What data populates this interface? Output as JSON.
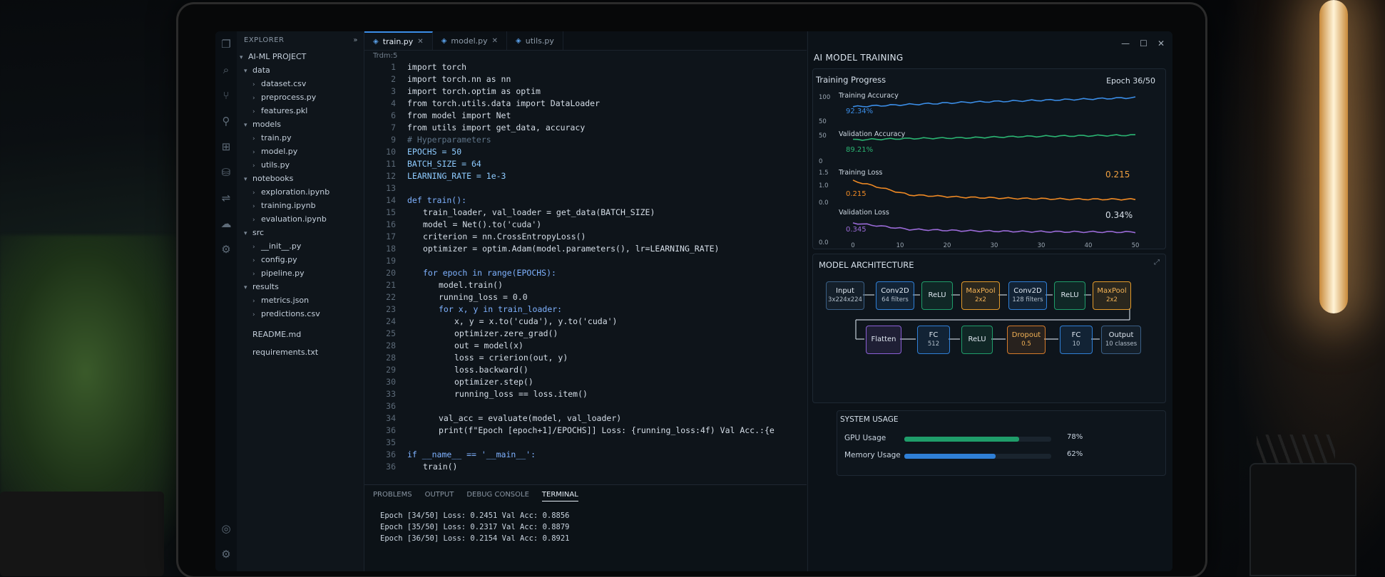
{
  "explorer": {
    "header": "EXPLORER",
    "project": "AI-ML PROJECT",
    "tree": [
      {
        "label": "data",
        "depth": 0,
        "folder": true,
        "open": true
      },
      {
        "label": "dataset.csv",
        "depth": 1,
        "folder": false
      },
      {
        "label": "preprocess.py",
        "depth": 1,
        "folder": false
      },
      {
        "label": "features.pkl",
        "depth": 1,
        "folder": false
      },
      {
        "label": "models",
        "depth": 0,
        "folder": true,
        "open": true
      },
      {
        "label": "train.py",
        "depth": 1,
        "folder": false
      },
      {
        "label": "model.py",
        "depth": 1,
        "folder": false
      },
      {
        "label": "utils.py",
        "depth": 1,
        "folder": false
      },
      {
        "label": "notebooks",
        "depth": 0,
        "folder": true,
        "open": true
      },
      {
        "label": "exploration.ipynb",
        "depth": 1,
        "folder": false
      },
      {
        "label": "training.ipynb",
        "depth": 1,
        "folder": false
      },
      {
        "label": "evaluation.ipynb",
        "depth": 1,
        "folder": false
      },
      {
        "label": "src",
        "depth": 0,
        "folder": true,
        "open": true
      },
      {
        "label": "__init__.py",
        "depth": 1,
        "folder": false
      },
      {
        "label": "config.py",
        "depth": 1,
        "folder": false
      },
      {
        "label": "pipeline.py",
        "depth": 1,
        "folder": false
      },
      {
        "label": "results",
        "depth": 0,
        "folder": true,
        "open": true
      },
      {
        "label": "metrics.json",
        "depth": 1,
        "folder": false
      },
      {
        "label": "predictions.csv",
        "depth": 1,
        "folder": false
      },
      {
        "label": "README.md",
        "depth": 0,
        "folder": false
      },
      {
        "label": "requirements.txt",
        "depth": 0,
        "folder": false
      }
    ]
  },
  "editor": {
    "tabs": [
      {
        "label": "train.py",
        "active": true
      },
      {
        "label": "model.py",
        "active": false
      },
      {
        "label": "utils.py",
        "active": false
      }
    ],
    "breadcrumb": "Trdm:5",
    "lines": [
      {
        "n": "1",
        "indent": 0,
        "text": "import torch",
        "cls": "ct"
      },
      {
        "n": "2",
        "indent": 0,
        "text": "import torch.nn as nn",
        "cls": "ct"
      },
      {
        "n": "3",
        "indent": 0,
        "text": "import torch.optim as optim",
        "cls": "ct"
      },
      {
        "n": "4",
        "indent": 0,
        "text": "from torch.utils.data import DataLoader",
        "cls": "ct"
      },
      {
        "n": "6",
        "indent": 0,
        "text": "from model import Net",
        "cls": "ct"
      },
      {
        "n": "7",
        "indent": 0,
        "text": "from utils import get_data, accuracy",
        "cls": "ct"
      },
      {
        "n": "9",
        "indent": 0,
        "text": "# Hyperparameters",
        "cls": "cm"
      },
      {
        "n": "10",
        "indent": 0,
        "text": "EPOCHS = 50",
        "cls": "cn"
      },
      {
        "n": "11",
        "indent": 0,
        "text": "BATCH_SIZE = 64",
        "cls": "cn"
      },
      {
        "n": "12",
        "indent": 0,
        "text": "LEARNING_RATE = 1e-3",
        "cls": "cn"
      },
      {
        "n": "13",
        "indent": 0,
        "text": "",
        "cls": "ct"
      },
      {
        "n": "14",
        "indent": 0,
        "text": "def train():",
        "cls": "kw"
      },
      {
        "n": "15",
        "indent": 1,
        "text": "train_loader, val_loader = get_data(BATCH_SIZE)",
        "cls": "ct"
      },
      {
        "n": "16",
        "indent": 1,
        "text": "model = Net().to('cuda')",
        "cls": "ct"
      },
      {
        "n": "17",
        "indent": 1,
        "text": "criterion = nn.CrossEntropyLoss()",
        "cls": "ct"
      },
      {
        "n": "18",
        "indent": 1,
        "text": "optimizer = optim.Adam(model.parameters(), lr=LEARNING_RATE)",
        "cls": "ct"
      },
      {
        "n": "19",
        "indent": 0,
        "text": "",
        "cls": "ct"
      },
      {
        "n": "20",
        "indent": 1,
        "text": "for epoch in range(EPOCHS):",
        "cls": "kw"
      },
      {
        "n": "21",
        "indent": 2,
        "text": "model.train()",
        "cls": "ct"
      },
      {
        "n": "22",
        "indent": 2,
        "text": "running_loss = 0.0",
        "cls": "ct"
      },
      {
        "n": "23",
        "indent": 2,
        "text": "for x, y in train_loader:",
        "cls": "kw"
      },
      {
        "n": "24",
        "indent": 3,
        "text": "x, y = x.to('cuda'), y.to('cuda')",
        "cls": "ct"
      },
      {
        "n": "25",
        "indent": 3,
        "text": "optimizer.zere_grad()",
        "cls": "ct"
      },
      {
        "n": "28",
        "indent": 3,
        "text": "out = model(x)",
        "cls": "ct"
      },
      {
        "n": "28",
        "indent": 3,
        "text": "loss = crierion(out, y)",
        "cls": "ct"
      },
      {
        "n": "29",
        "indent": 3,
        "text": "loss.backward()",
        "cls": "ct"
      },
      {
        "n": "30",
        "indent": 3,
        "text": "optimizer.step()",
        "cls": "ct"
      },
      {
        "n": "33",
        "indent": 3,
        "text": "running_loss == loss.item()",
        "cls": "ct"
      },
      {
        "n": "36",
        "indent": 0,
        "text": "",
        "cls": "ct"
      },
      {
        "n": "34",
        "indent": 2,
        "text": "val_acc = evaluate(model, val_loader)",
        "cls": "ct"
      },
      {
        "n": "36",
        "indent": 2,
        "text": "print(f\"Epoch [epoch+1]/EPOCHS]] Loss: {running_loss:4f) Val Acc.:{e",
        "cls": "ct"
      },
      {
        "n": "35",
        "indent": 2,
        "text": "",
        "cls": "ct"
      },
      {
        "n": "36",
        "indent": 0,
        "text": "if __name__ == '__main__':",
        "cls": "kw"
      },
      {
        "n": "36",
        "indent": 1,
        "text": "train()",
        "cls": "ct"
      }
    ]
  },
  "panel": {
    "tabs": [
      {
        "label": "PROBLEMS",
        "active": false
      },
      {
        "label": "OUTPUT",
        "active": false
      },
      {
        "label": "DEBUG CONSOLE",
        "active": false
      },
      {
        "label": "TERMINAL",
        "active": true
      }
    ],
    "lines": [
      "Epoch [34/50] Loss: 0.2451 Val Acc: 0.8856",
      "Epoch [35/50] Loss: 0.2317 Val Acc: 0.8879",
      "Epoch [36/50] Loss: 0.2154 Val Acc: 0.8921"
    ]
  },
  "right": {
    "title": "AI MODEL TRAINING",
    "progress_title": "Training Progress",
    "epoch_label": "Epoch 36/50",
    "arch_title": "MODEL ARCHITECTURE",
    "sys_title": "SYSTEM USAGE",
    "gpu_label": "GPU Usage",
    "gpu_value": "78%",
    "gpu_fraction": 0.78,
    "mem_label": "Memory Usage",
    "mem_value": "62%",
    "mem_fraction": 0.62,
    "colors": {
      "gpu": "#1f9d6a",
      "mem": "#2f7fd6"
    },
    "arch": {
      "row1": [
        {
          "label": "Input",
          "sub": "3x224x224",
          "color": "#3a5f86"
        },
        {
          "label": "Conv2D",
          "sub": "64 filters",
          "color": "#2f7fd6"
        },
        {
          "label": "ReLU",
          "sub": "",
          "color": "#1f9d6a"
        },
        {
          "label": "MaxPool",
          "sub": "2x2",
          "color": "#e39a2a"
        },
        {
          "label": "Conv2D",
          "sub": "128 filters",
          "color": "#2f7fd6"
        },
        {
          "label": "ReLU",
          "sub": "",
          "color": "#1f9d6a"
        },
        {
          "label": "MaxPool",
          "sub": "2x2",
          "color": "#e39a2a"
        }
      ],
      "row2": [
        {
          "label": "Flatten",
          "sub": "",
          "color": "#8b5fd6"
        },
        {
          "label": "FC",
          "sub": "512",
          "color": "#2f7fd6"
        },
        {
          "label": "ReLU",
          "sub": "",
          "color": "#1f9d6a"
        },
        {
          "label": "Dropout",
          "sub": "0.5",
          "color": "#d47a2a"
        },
        {
          "label": "FC",
          "sub": "10",
          "color": "#2f7fd6"
        },
        {
          "label": "Output",
          "sub": "10 classes",
          "color": "#3a5f86"
        }
      ]
    }
  },
  "chart_data": {
    "type": "line",
    "x_ticks": [
      "0",
      "10",
      "20",
      "30",
      "30",
      "40",
      "50"
    ],
    "x": [
      0,
      10,
      20,
      30,
      40,
      50
    ],
    "xlim": [
      0,
      50
    ],
    "series": [
      {
        "name": "Training Accuracy",
        "value_label": "92.34%",
        "color": "#3b8ee8",
        "ylim": [
          50,
          100
        ],
        "y_ticks": [
          "100",
          "50"
        ],
        "values": [
          80,
          83,
          86,
          88,
          90,
          92.3
        ]
      },
      {
        "name": "Validation Accuracy",
        "value_label": "89.21%",
        "color": "#2bb673",
        "ylim": [
          0,
          50
        ],
        "y_ticks": [
          "50",
          "0"
        ],
        "values": [
          38,
          40,
          41,
          43,
          44,
          45
        ]
      },
      {
        "name": "Training Loss",
        "value_label": "0.215",
        "value_label2": "0.215",
        "color": "#f08a24",
        "ylim": [
          0.0,
          1.5
        ],
        "y_ticks": [
          "1.5",
          "1.0",
          "0.0"
        ],
        "values": [
          1.0,
          0.4,
          0.3,
          0.25,
          0.22,
          0.215
        ]
      },
      {
        "name": "Validation Loss",
        "value_label": "0.345",
        "value_label2": "0.34%",
        "color": "#9b6bd8",
        "ylim": [
          0.0,
          1.0
        ],
        "y_ticks": [
          "0.0"
        ],
        "values": [
          0.6,
          0.42,
          0.38,
          0.36,
          0.35,
          0.345
        ]
      }
    ]
  }
}
